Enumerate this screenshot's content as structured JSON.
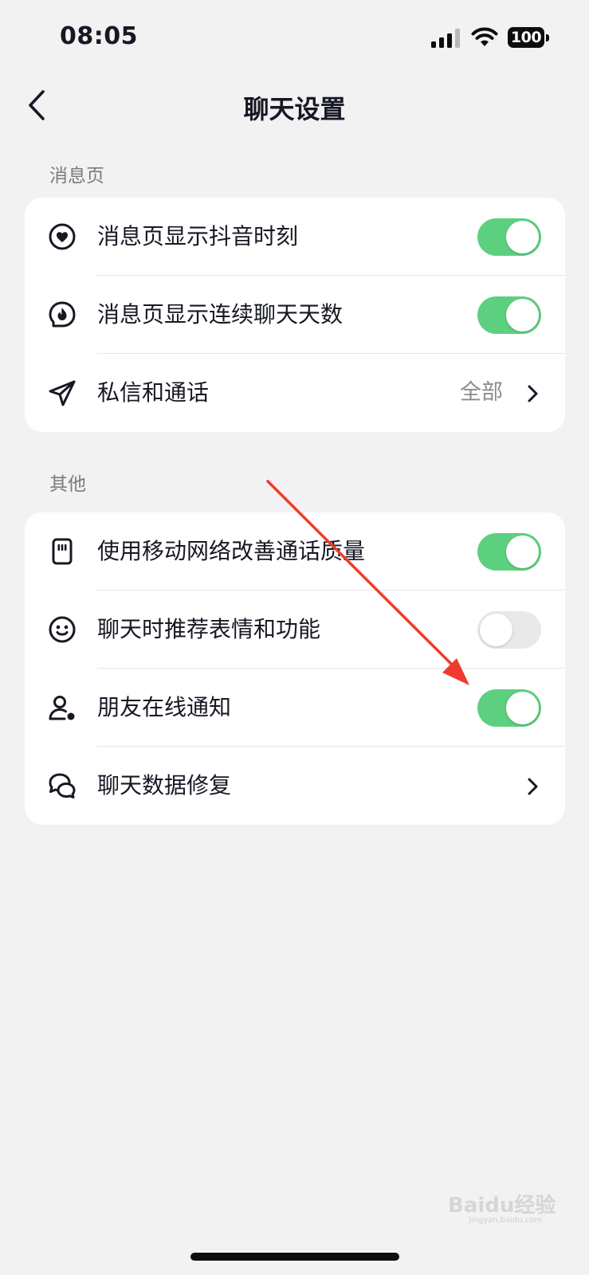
{
  "status_bar": {
    "time": "08:05",
    "battery": "100",
    "icons": [
      "signal-icon",
      "wifi-icon",
      "battery-icon"
    ]
  },
  "nav": {
    "title": "聊天设置",
    "back_icon": "chevron-left-icon"
  },
  "sections": [
    {
      "label": "消息页",
      "rows": [
        {
          "icon": "heart-circle-icon",
          "label": "消息页显示抖音时刻",
          "control": "toggle",
          "on": true
        },
        {
          "icon": "flame-chat-icon",
          "label": "消息页显示连续聊天天数",
          "control": "toggle",
          "on": true
        },
        {
          "icon": "send-icon",
          "label": "私信和通话",
          "control": "link",
          "value": "全部"
        }
      ]
    },
    {
      "label": "其他",
      "rows": [
        {
          "icon": "sim-card-icon",
          "label": "使用移动网络改善通话质量",
          "control": "toggle",
          "on": true
        },
        {
          "icon": "smile-icon",
          "label": "聊天时推荐表情和功能",
          "control": "toggle",
          "on": false
        },
        {
          "icon": "user-online-icon",
          "label": "朋友在线通知",
          "control": "toggle",
          "on": true
        },
        {
          "icon": "chat-bubbles-icon",
          "label": "聊天数据修复",
          "control": "link",
          "value": ""
        }
      ]
    }
  ],
  "annotation": {
    "icon": "red-arrow-icon",
    "color": "#f03a2f"
  },
  "watermark": {
    "text": "Baidu经验",
    "sub": "jingyan.baidu.com"
  },
  "colors": {
    "toggle_on": "#5dd07f",
    "toggle_off": "#e9e9eb",
    "background": "#f2f2f2"
  }
}
